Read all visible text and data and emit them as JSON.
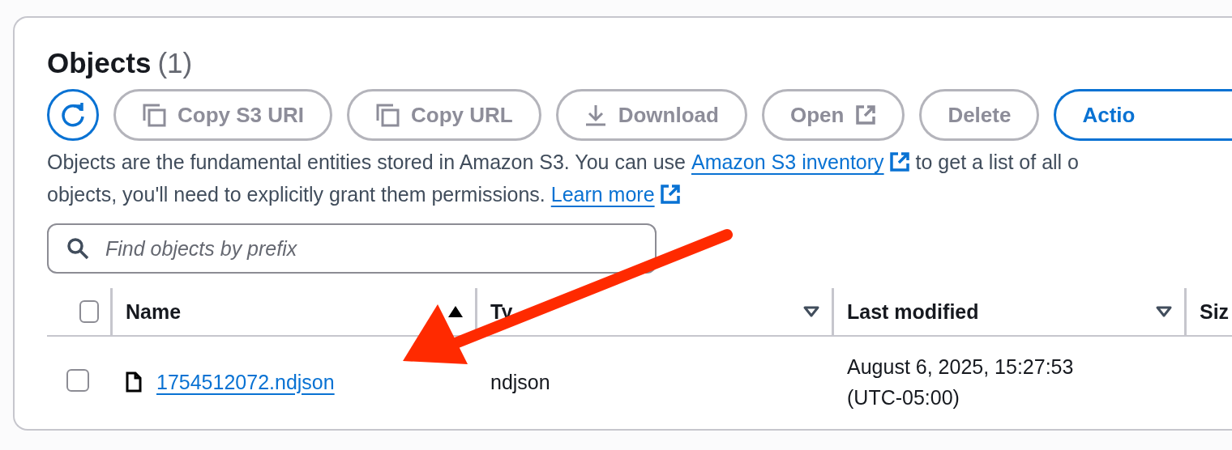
{
  "panel": {
    "title": "Objects",
    "count": "(1)"
  },
  "toolbar": [
    {
      "kind": "refresh",
      "disabled": false
    },
    {
      "kind": "copy",
      "label": "Copy S3 URI",
      "disabled": true
    },
    {
      "kind": "copy",
      "label": "Copy URL",
      "disabled": true
    },
    {
      "kind": "download",
      "label": "Download",
      "disabled": true
    },
    {
      "kind": "open",
      "label": "Open",
      "disabled": true
    },
    {
      "kind": "plain",
      "label": "Delete",
      "disabled": true
    },
    {
      "kind": "plain",
      "label": "Actio",
      "disabled": false
    }
  ],
  "description": [
    [
      {
        "text": "Objects are the fundamental entities stored in Amazon S3. You can use "
      },
      {
        "link": "Amazon S3 inventory"
      },
      {
        "text": " to get a list of all o"
      }
    ],
    [
      {
        "text": "objects, you'll need to explicitly grant them permissions. "
      },
      {
        "link": "Learn more"
      }
    ]
  ],
  "search": {
    "placeholder": "Find objects by prefix"
  },
  "table": {
    "select_all": {
      "checked": false
    },
    "columns": [
      {
        "label": "Name",
        "sorted": true
      },
      {
        "label": "Ty",
        "sorted": false
      },
      {
        "label": "Last modified",
        "sorted": false
      },
      {
        "label": "Siz"
      }
    ],
    "rows": [
      {
        "checked": false,
        "name": "1754512072.ndjson",
        "type": "ndjson",
        "last_modified": "August 6, 2025, 15:27:53 (UTC-05:00)"
      }
    ]
  }
}
